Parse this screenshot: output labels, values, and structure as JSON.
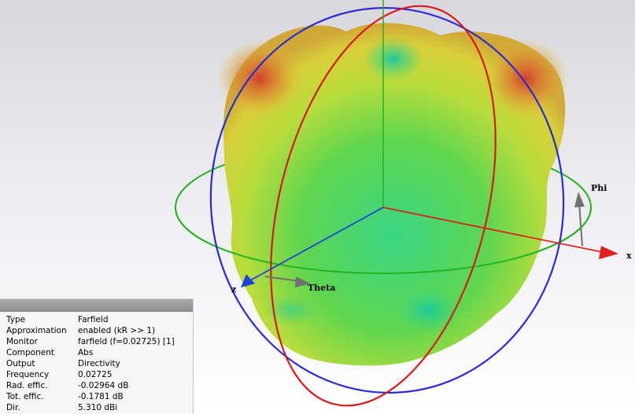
{
  "scene": {
    "axes": {
      "x_label": "x",
      "z_label": "z",
      "phi_label": "Phi",
      "theta_label": "Theta"
    },
    "colors": {
      "x_axis": "#e02020",
      "z_axis": "#2040e0",
      "y_axis": "#22b422",
      "phi_ring": "#22b422",
      "theta_ring_red": "#d81a1a",
      "theta_ring_blue": "#2a2ad6",
      "pattern_high": "#d8442a",
      "pattern_mid": "#d8d83a",
      "pattern_low": "#2ed47a"
    }
  },
  "info": {
    "rows": [
      {
        "key": "Type",
        "value": "Farfield"
      },
      {
        "key": "Approximation",
        "value": "enabled (kR >> 1)"
      },
      {
        "key": "Monitor",
        "value": "farfield (f=0.02725) [1]"
      },
      {
        "key": "Component",
        "value": "Abs"
      },
      {
        "key": "Output",
        "value": "Directivity"
      },
      {
        "key": "Frequency",
        "value": "0.02725"
      },
      {
        "key": "Rad. effic.",
        "value": "-0.02964 dB"
      },
      {
        "key": "Tot. effic.",
        "value": "-0.1781 dB"
      },
      {
        "key": "Dir.",
        "value": "5.310 dBi"
      }
    ]
  }
}
